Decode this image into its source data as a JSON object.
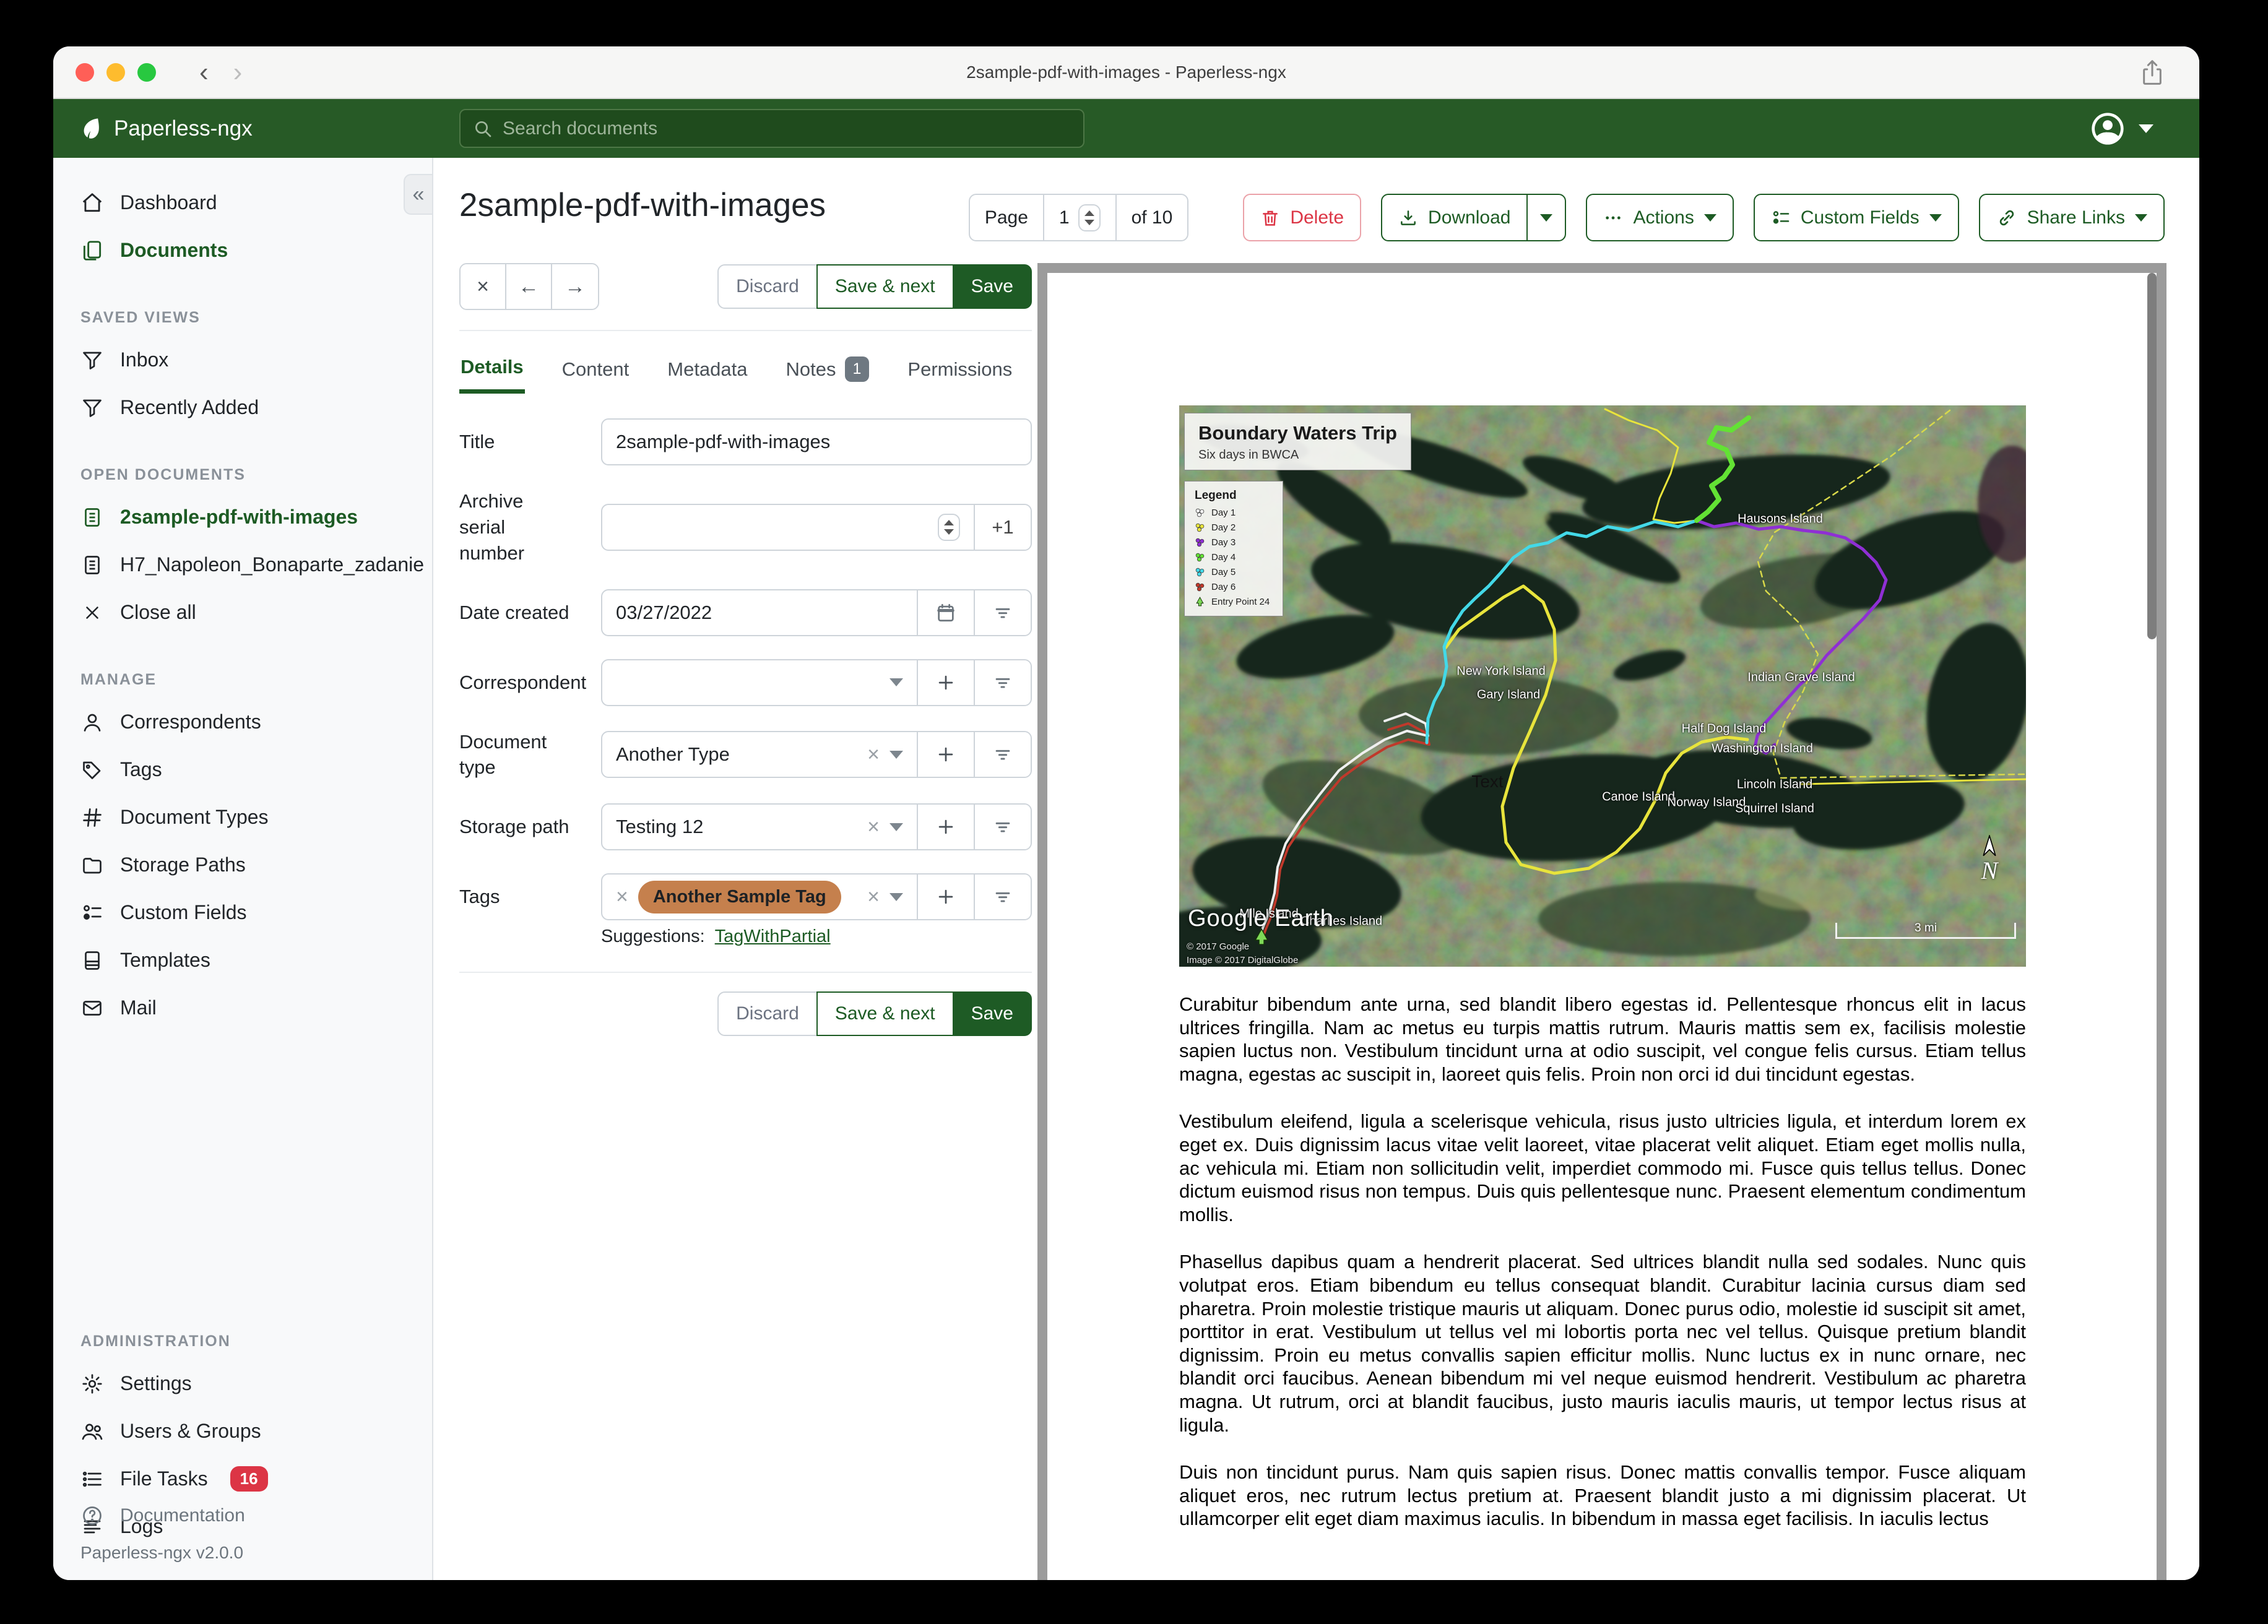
{
  "window": {
    "title": "2sample-pdf-with-images - Paperless-ngx"
  },
  "navbar": {
    "brand": "Paperless-ngx",
    "search_placeholder": "Search documents"
  },
  "sidebar": {
    "dashboard": "Dashboard",
    "documents": "Documents",
    "sections": {
      "saved_views": {
        "title": "SAVED VIEWS",
        "inbox": "Inbox",
        "recently_added": "Recently Added"
      },
      "open_documents": {
        "title": "OPEN DOCUMENTS",
        "doc1": "2sample-pdf-with-images",
        "doc2": "H7_Napoleon_Bonaparte_zadanie",
        "close_all": "Close all"
      },
      "manage": {
        "title": "MANAGE",
        "correspondents": "Correspondents",
        "tags": "Tags",
        "document_types": "Document Types",
        "storage_paths": "Storage Paths",
        "custom_fields": "Custom Fields",
        "templates": "Templates",
        "mail": "Mail"
      },
      "administration": {
        "title": "ADMINISTRATION",
        "settings": "Settings",
        "users_groups": "Users & Groups",
        "file_tasks": "File Tasks",
        "file_tasks_badge": "16",
        "logs": "Logs"
      }
    },
    "documentation": "Documentation",
    "version": "Paperless-ngx v2.0.0"
  },
  "toolbar": {
    "page_label": "Page",
    "page_value": "1",
    "page_of": "of 10",
    "delete_label": "Delete",
    "download_label": "Download",
    "actions_label": "Actions",
    "custom_fields_label": "Custom Fields",
    "share_links_label": "Share Links"
  },
  "editor": {
    "title": "2sample-pdf-with-images",
    "discard_label": "Discard",
    "save_next_label": "Save & next",
    "save_label": "Save",
    "tabs": {
      "details": "Details",
      "content": "Content",
      "metadata": "Metadata",
      "notes": "Notes",
      "notes_badge": "1",
      "permissions": "Permissions"
    },
    "fields": {
      "title_label": "Title",
      "title_value": "2sample-pdf-with-images",
      "asn_label": "Archive serial number",
      "asn_increment": "+1",
      "date_label": "Date created",
      "date_value": "03/27/2022",
      "correspondent_label": "Correspondent",
      "doctype_label": "Document type",
      "doctype_value": "Another Type",
      "storage_label": "Storage path",
      "storage_value": "Testing 12",
      "tags_label": "Tags",
      "tag_chip": "Another Sample Tag",
      "suggestions_label": "Suggestions:",
      "suggestion_link": "TagWithPartial"
    }
  },
  "preview": {
    "map": {
      "title": "Boundary Waters Trip",
      "subtitle": "Six days in BWCA",
      "legend_title": "Legend",
      "legend": [
        {
          "label": "Day 1",
          "color": "#f0f0f0"
        },
        {
          "label": "Day 2",
          "color": "#e8e43c"
        },
        {
          "label": "Day 3",
          "color": "#8f2fd4"
        },
        {
          "label": "Day 4",
          "color": "#63e234"
        },
        {
          "label": "Day 5",
          "color": "#43d9e8"
        },
        {
          "label": "Day 6",
          "color": "#c0392b"
        },
        {
          "label": "Entry Point 24",
          "color": "#7ed957"
        }
      ],
      "labels": [
        "Hausons Island",
        "New York Island",
        "Gary Island",
        "Indian Grave Island",
        "Half Dog Island",
        "Washington Island",
        "Lincoln Island",
        "Canoe Island",
        "Norway Island",
        "Squirrel Island",
        "Mile Island",
        "Charlies Island"
      ],
      "text_annotation": "Text",
      "attribution": "Google Earth",
      "copyright_line1": "© 2017 Google",
      "copyright_line2": "Image © 2017 DigitalGlobe",
      "north_label": "N",
      "scale_label": "3 mi"
    },
    "paragraphs": [
      "Curabitur bibendum ante urna, sed blandit libero egestas id. Pellentesque rhoncus elit in lacus ultrices fringilla. Nam ac metus eu turpis mattis rutrum. Mauris mattis sem ex, facilisis molestie sapien luctus non. Vestibulum tincidunt urna at odio suscipit, vel congue felis cursus. Etiam tellus magna, egestas ac suscipit in, laoreet quis felis. Proin non orci id dui tincidunt egestas.",
      "Vestibulum eleifend, ligula a scelerisque vehicula, risus justo ultricies ligula, et interdum lorem ex eget ex. Duis dignissim lacus vitae velit laoreet, vitae placerat velit aliquet. Etiam eget mollis nulla, ac vehicula mi. Etiam non sollicitudin velit, imperdiet commodo mi. Fusce quis tellus tellus. Donec dictum euismod risus non tempus. Duis quis pellentesque nunc. Praesent elementum condimentum mollis.",
      "Phasellus dapibus quam a hendrerit placerat. Sed ultrices blandit nulla sed sodales. Nunc quis volutpat eros. Etiam bibendum eu tellus consequat blandit. Curabitur lacinia cursus diam sed pharetra. Proin molestie tristique mauris ut aliquam. Donec purus odio, molestie id suscipit sit amet, porttitor in erat. Vestibulum ut tellus vel mi lobortis porta nec vel tellus. Quisque pretium blandit dignissim. Proin eu metus convallis sapien efficitur mollis. Nunc luctus ex in nunc ornare, nec blandit orci faucibus. Aenean bibendum mi vel neque euismod hendrerit. Vestibulum ac pharetra magna. Ut rutrum, orci at blandit faucibus, justo mauris iaculis mauris, ut tempor lectus risus at ligula.",
      "Duis non tincidunt purus. Nam quis sapien risus. Donec mattis convallis tempor. Fusce aliquam aliquet eros, nec rutrum lectus pretium at. Praesent blandit justo a mi dignissim placerat. Ut ullamcorper elit eget diam maximus iaculis. In bibendum in massa eget facilisis. In iaculis lectus"
    ]
  }
}
